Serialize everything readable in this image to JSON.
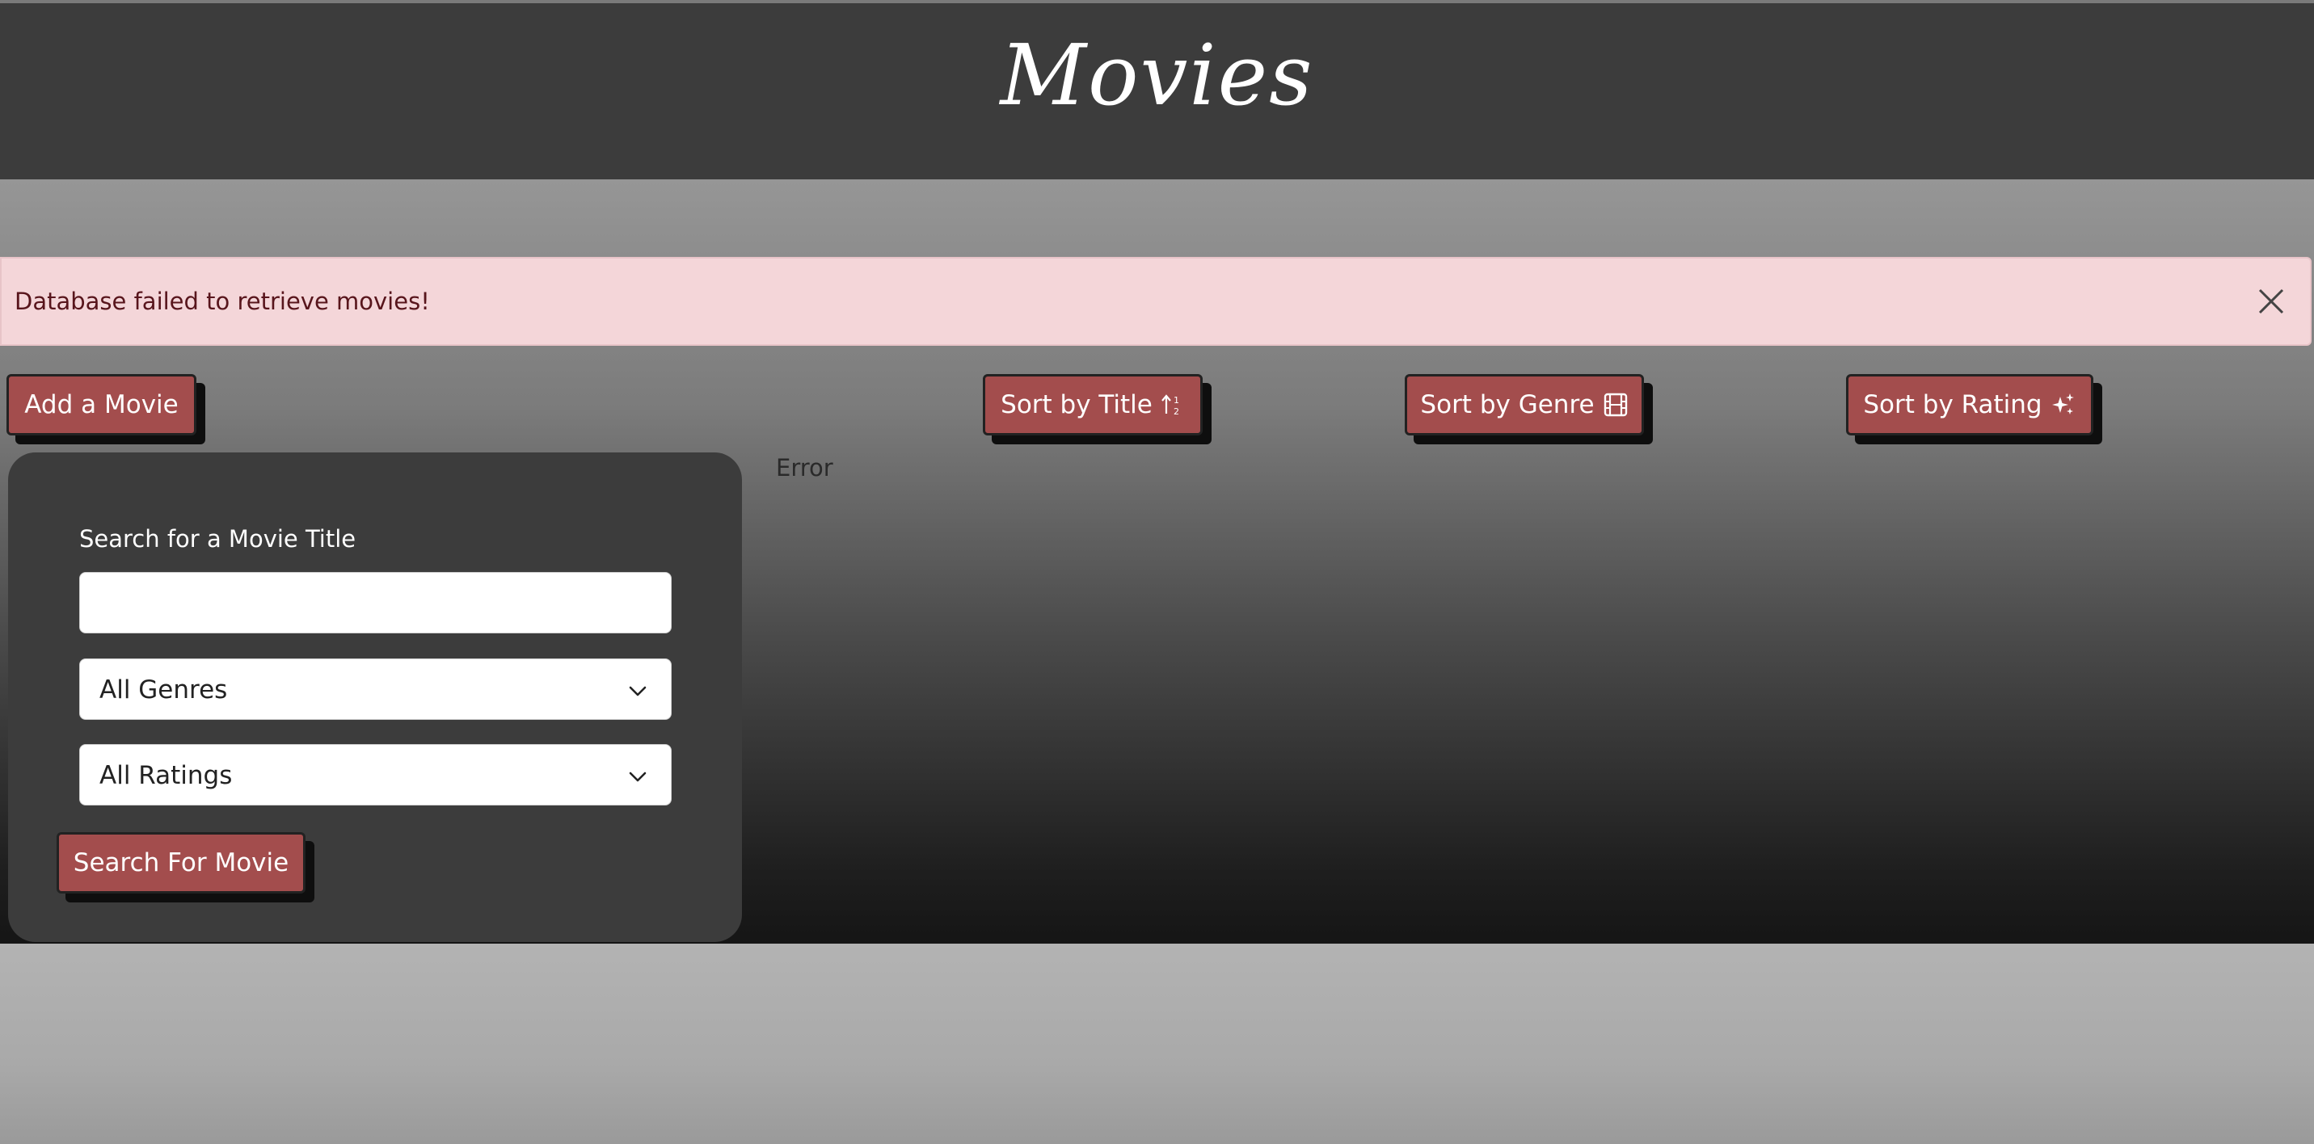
{
  "header": {
    "title": "Movies"
  },
  "alert": {
    "message": "Database failed to retrieve movies!",
    "close_icon": "close-icon"
  },
  "toolbar": {
    "add_label": "Add a Movie",
    "sort_title_label": "Sort by Title",
    "sort_genre_label": "Sort by Genre",
    "sort_rating_label": "Sort by Rating"
  },
  "search": {
    "label": "Search for a Movie Title",
    "value": "",
    "genre_selected": "All Genres",
    "rating_selected": "All Ratings",
    "submit_label": "Search For Movie"
  },
  "content": {
    "status": "Error"
  },
  "colors": {
    "header_bg": "#3c3c3c",
    "button_bg": "#a34d4d",
    "alert_bg": "#f4d6d9",
    "alert_text": "#58151c",
    "panel_bg": "#3c3c3c"
  }
}
